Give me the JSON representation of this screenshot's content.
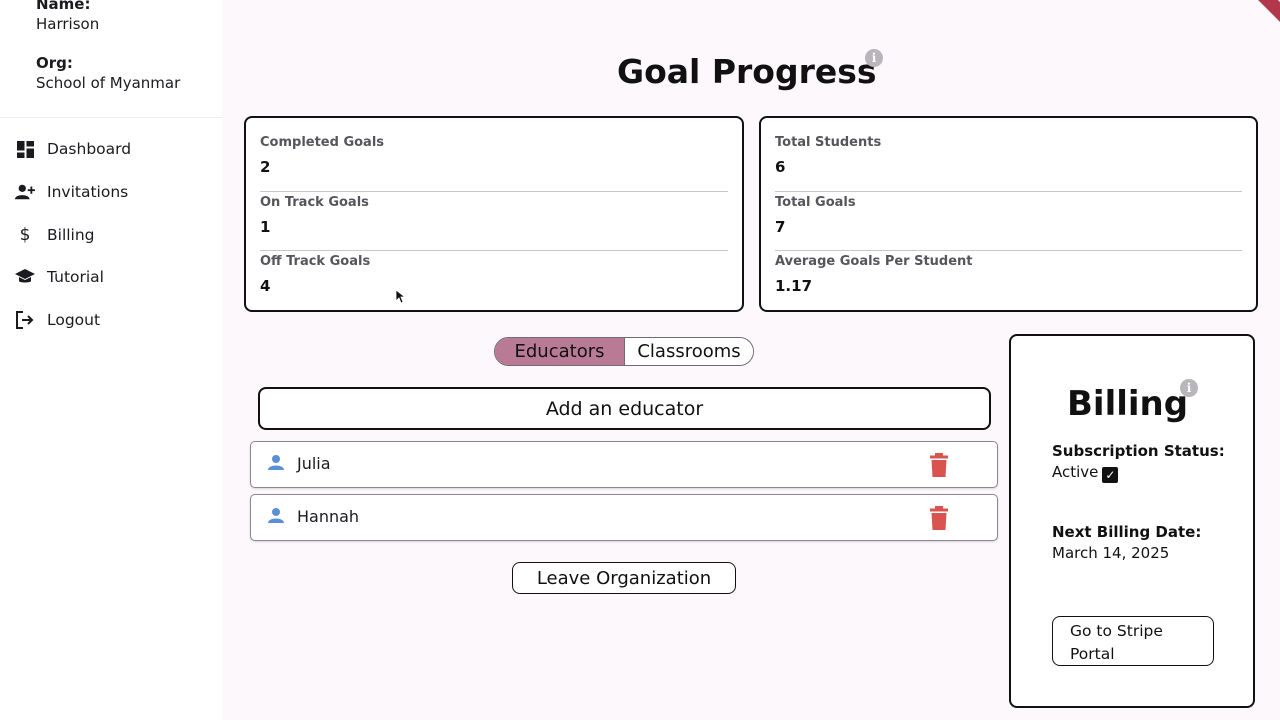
{
  "sidebar": {
    "name_label": "Name:",
    "name_value": "Harrison",
    "org_label": "Org:",
    "org_value": "School of Myanmar",
    "items": [
      {
        "label": "Dashboard",
        "icon": "dashboard-icon"
      },
      {
        "label": "Invitations",
        "icon": "person-add-icon"
      },
      {
        "label": "Billing",
        "icon": "dollar-icon"
      },
      {
        "label": "Tutorial",
        "icon": "school-icon"
      },
      {
        "label": "Logout",
        "icon": "logout-icon"
      }
    ]
  },
  "main": {
    "title": "Goal Progress",
    "goal_stats": [
      {
        "label": "Completed Goals",
        "value": "2"
      },
      {
        "label": "On Track Goals",
        "value": "1"
      },
      {
        "label": "Off Track Goals",
        "value": "4"
      }
    ],
    "student_stats": [
      {
        "label": "Total Students",
        "value": "6"
      },
      {
        "label": "Total Goals",
        "value": "7"
      },
      {
        "label": "Average Goals Per Student",
        "value": "1.17"
      }
    ],
    "tabs": {
      "active": "Educators",
      "inactive": "Classrooms"
    },
    "add_educator_label": "Add an educator",
    "educators": [
      "Julia",
      "Hannah"
    ],
    "leave_label": "Leave Organization"
  },
  "billing": {
    "title": "Billing",
    "status_label": "Subscription Status:",
    "status_value": "Active",
    "next_label": "Next Billing Date:",
    "next_value": "March 14, 2025",
    "stripe_line1": "Go to Stripe",
    "stripe_line2": "Portal"
  },
  "colors": {
    "accent": "#b97a96",
    "delete": "#d9534f",
    "person_icon": "#5b8fd6",
    "background": "#fcf8fc"
  }
}
